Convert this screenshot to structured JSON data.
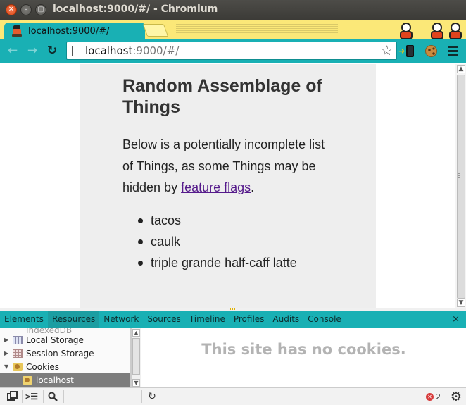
{
  "window": {
    "title": "localhost:9000/#/ - Chromium"
  },
  "tab": {
    "label": "localhost:9000/#/",
    "close": "×"
  },
  "toolbar": {
    "url_host": "localhost",
    "url_path": ":9000/#/",
    "back": "←",
    "forward": "→",
    "reload": "↻",
    "star": "☆"
  },
  "page": {
    "heading": "Random Assemblage of Things",
    "para_before": "Below is a potentially incomplete list of Things, as some Things may be hidden by ",
    "link_text": "feature flags",
    "para_after": ".",
    "items": [
      "tacos",
      "caulk",
      "triple grande half-caff latte"
    ]
  },
  "devtools": {
    "tabs": [
      "Elements",
      "Resources",
      "Network",
      "Sources",
      "Timeline",
      "Profiles",
      "Audits",
      "Console"
    ],
    "active_tab": "Resources",
    "close": "×",
    "tree": {
      "partial_item": "IndexedDB",
      "items": [
        {
          "label": "Local Storage",
          "icon": "local-storage-icon"
        },
        {
          "label": "Session Storage",
          "icon": "session-storage-icon"
        },
        {
          "label": "Cookies",
          "icon": "cookies-icon"
        },
        {
          "label": "localhost",
          "icon": "cookie-icon"
        }
      ]
    },
    "empty_message": "This site has no cookies.",
    "status": {
      "error_count": "2"
    }
  }
}
